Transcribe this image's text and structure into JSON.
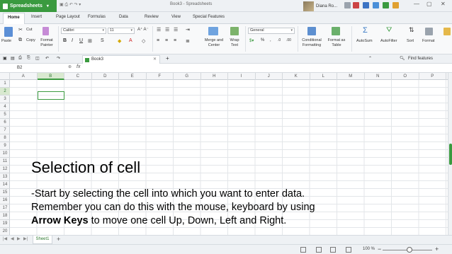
{
  "app": {
    "name": "Spreadsheets",
    "window_title": "Book3 - Spreadsheets",
    "user": "Diana Ro..."
  },
  "menu": {
    "tabs": [
      "Home",
      "Insert",
      "Page Layout",
      "Formulas",
      "Data",
      "Review",
      "View",
      "Special Features"
    ]
  },
  "ribbon": {
    "cut": "Cut",
    "paste": "Paste",
    "copy": "Copy",
    "format_painter": "Format Painter",
    "font_name": "Calibri",
    "font_size": "11",
    "merge_center": "Merge and Center",
    "wrap_text": "Wrap Text",
    "number_format": "General",
    "conditional_formatting": "Conditional Formatting",
    "format_as_table": "Format as Table",
    "autosum": "AutoSum",
    "autofilter": "AutoFilter",
    "sort": "Sort",
    "format": "Format",
    "find": "Find features"
  },
  "document": {
    "tab_name": "Book3"
  },
  "formula_bar": {
    "name_box": "B2",
    "fx": "fx"
  },
  "grid": {
    "columns": [
      "A",
      "B",
      "C",
      "D",
      "E",
      "F",
      "G",
      "H",
      "I",
      "J",
      "K",
      "L",
      "M",
      "N",
      "O",
      "P"
    ],
    "rows": [
      "1",
      "2",
      "3",
      "4",
      "5",
      "6",
      "7",
      "8",
      "9",
      "10",
      "11",
      "12",
      "13",
      "14",
      "15",
      "16",
      "17",
      "18",
      "19",
      "20",
      "21"
    ],
    "selected_column": "B",
    "selected_row": "2"
  },
  "slide": {
    "title": "Selection of cell",
    "line1": "-Start by selecting the cell into which you want to enter data.",
    "line2": " Remember you can do this with the mouse, keyboard by using",
    "line3_bold": "Arrow Keys",
    "line3_rest": " to move one cell Up, Down, Left and Right."
  },
  "sheets": {
    "tabs": [
      "Sheet1"
    ],
    "add": "+"
  },
  "status": {
    "zoom": "100 %"
  },
  "colors": {
    "accent": "#3a9a3f"
  }
}
